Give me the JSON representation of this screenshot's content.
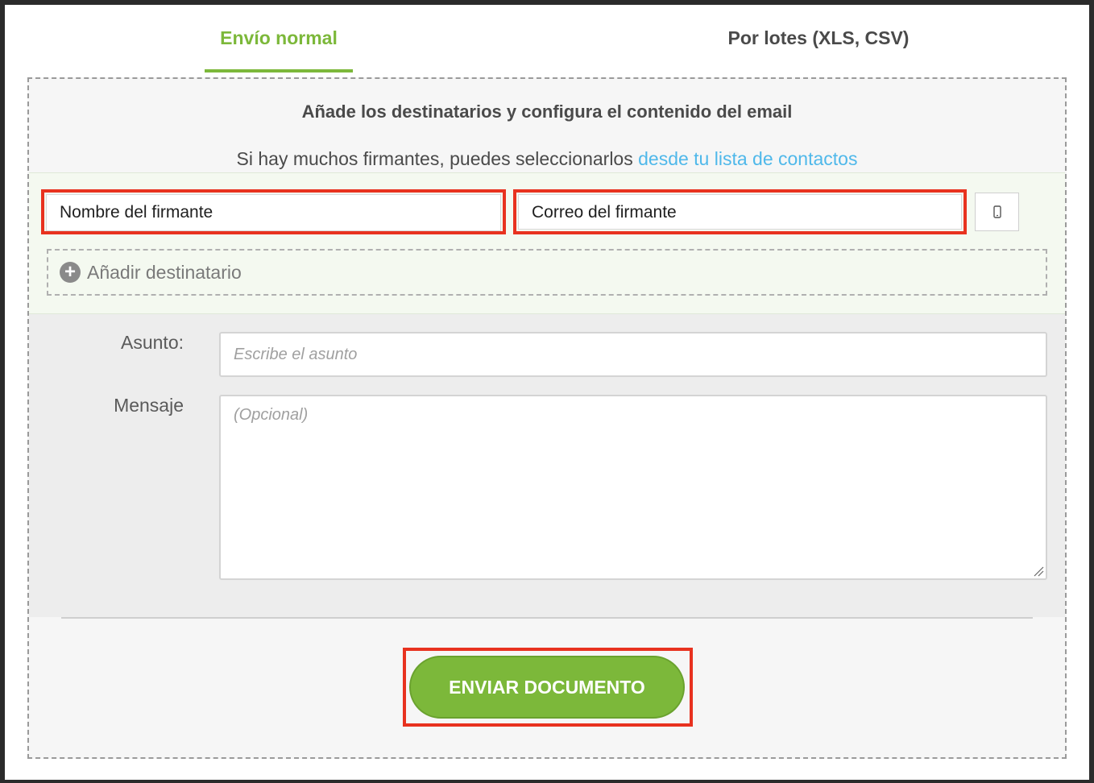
{
  "tabs": [
    {
      "label": "Envío normal",
      "active": true
    },
    {
      "label": "Por lotes (XLS, CSV)",
      "active": false
    }
  ],
  "header": {
    "heading": "Añade los destinatarios y configura el contenido del email",
    "intro_text": "Si hay muchos firmantes, puedes seleccionarlos ",
    "intro_link": "desde tu lista de contactos"
  },
  "recipients": {
    "name_value": "Nombre del firmante",
    "email_value": "Correo del firmante",
    "phone_button_icon": "mobile-phone-icon",
    "add_recipient_label": "Añadir destinatario"
  },
  "email_config": {
    "subject_label": "Asunto:",
    "subject_placeholder": "Escribe el asunto",
    "message_label": "Mensaje",
    "message_placeholder": "(Opcional)"
  },
  "actions": {
    "send_label": "ENVIAR DOCUMENTO"
  },
  "colors": {
    "accent": "#7cb83a",
    "link": "#4fb8ea",
    "highlight": "#e8321f"
  }
}
